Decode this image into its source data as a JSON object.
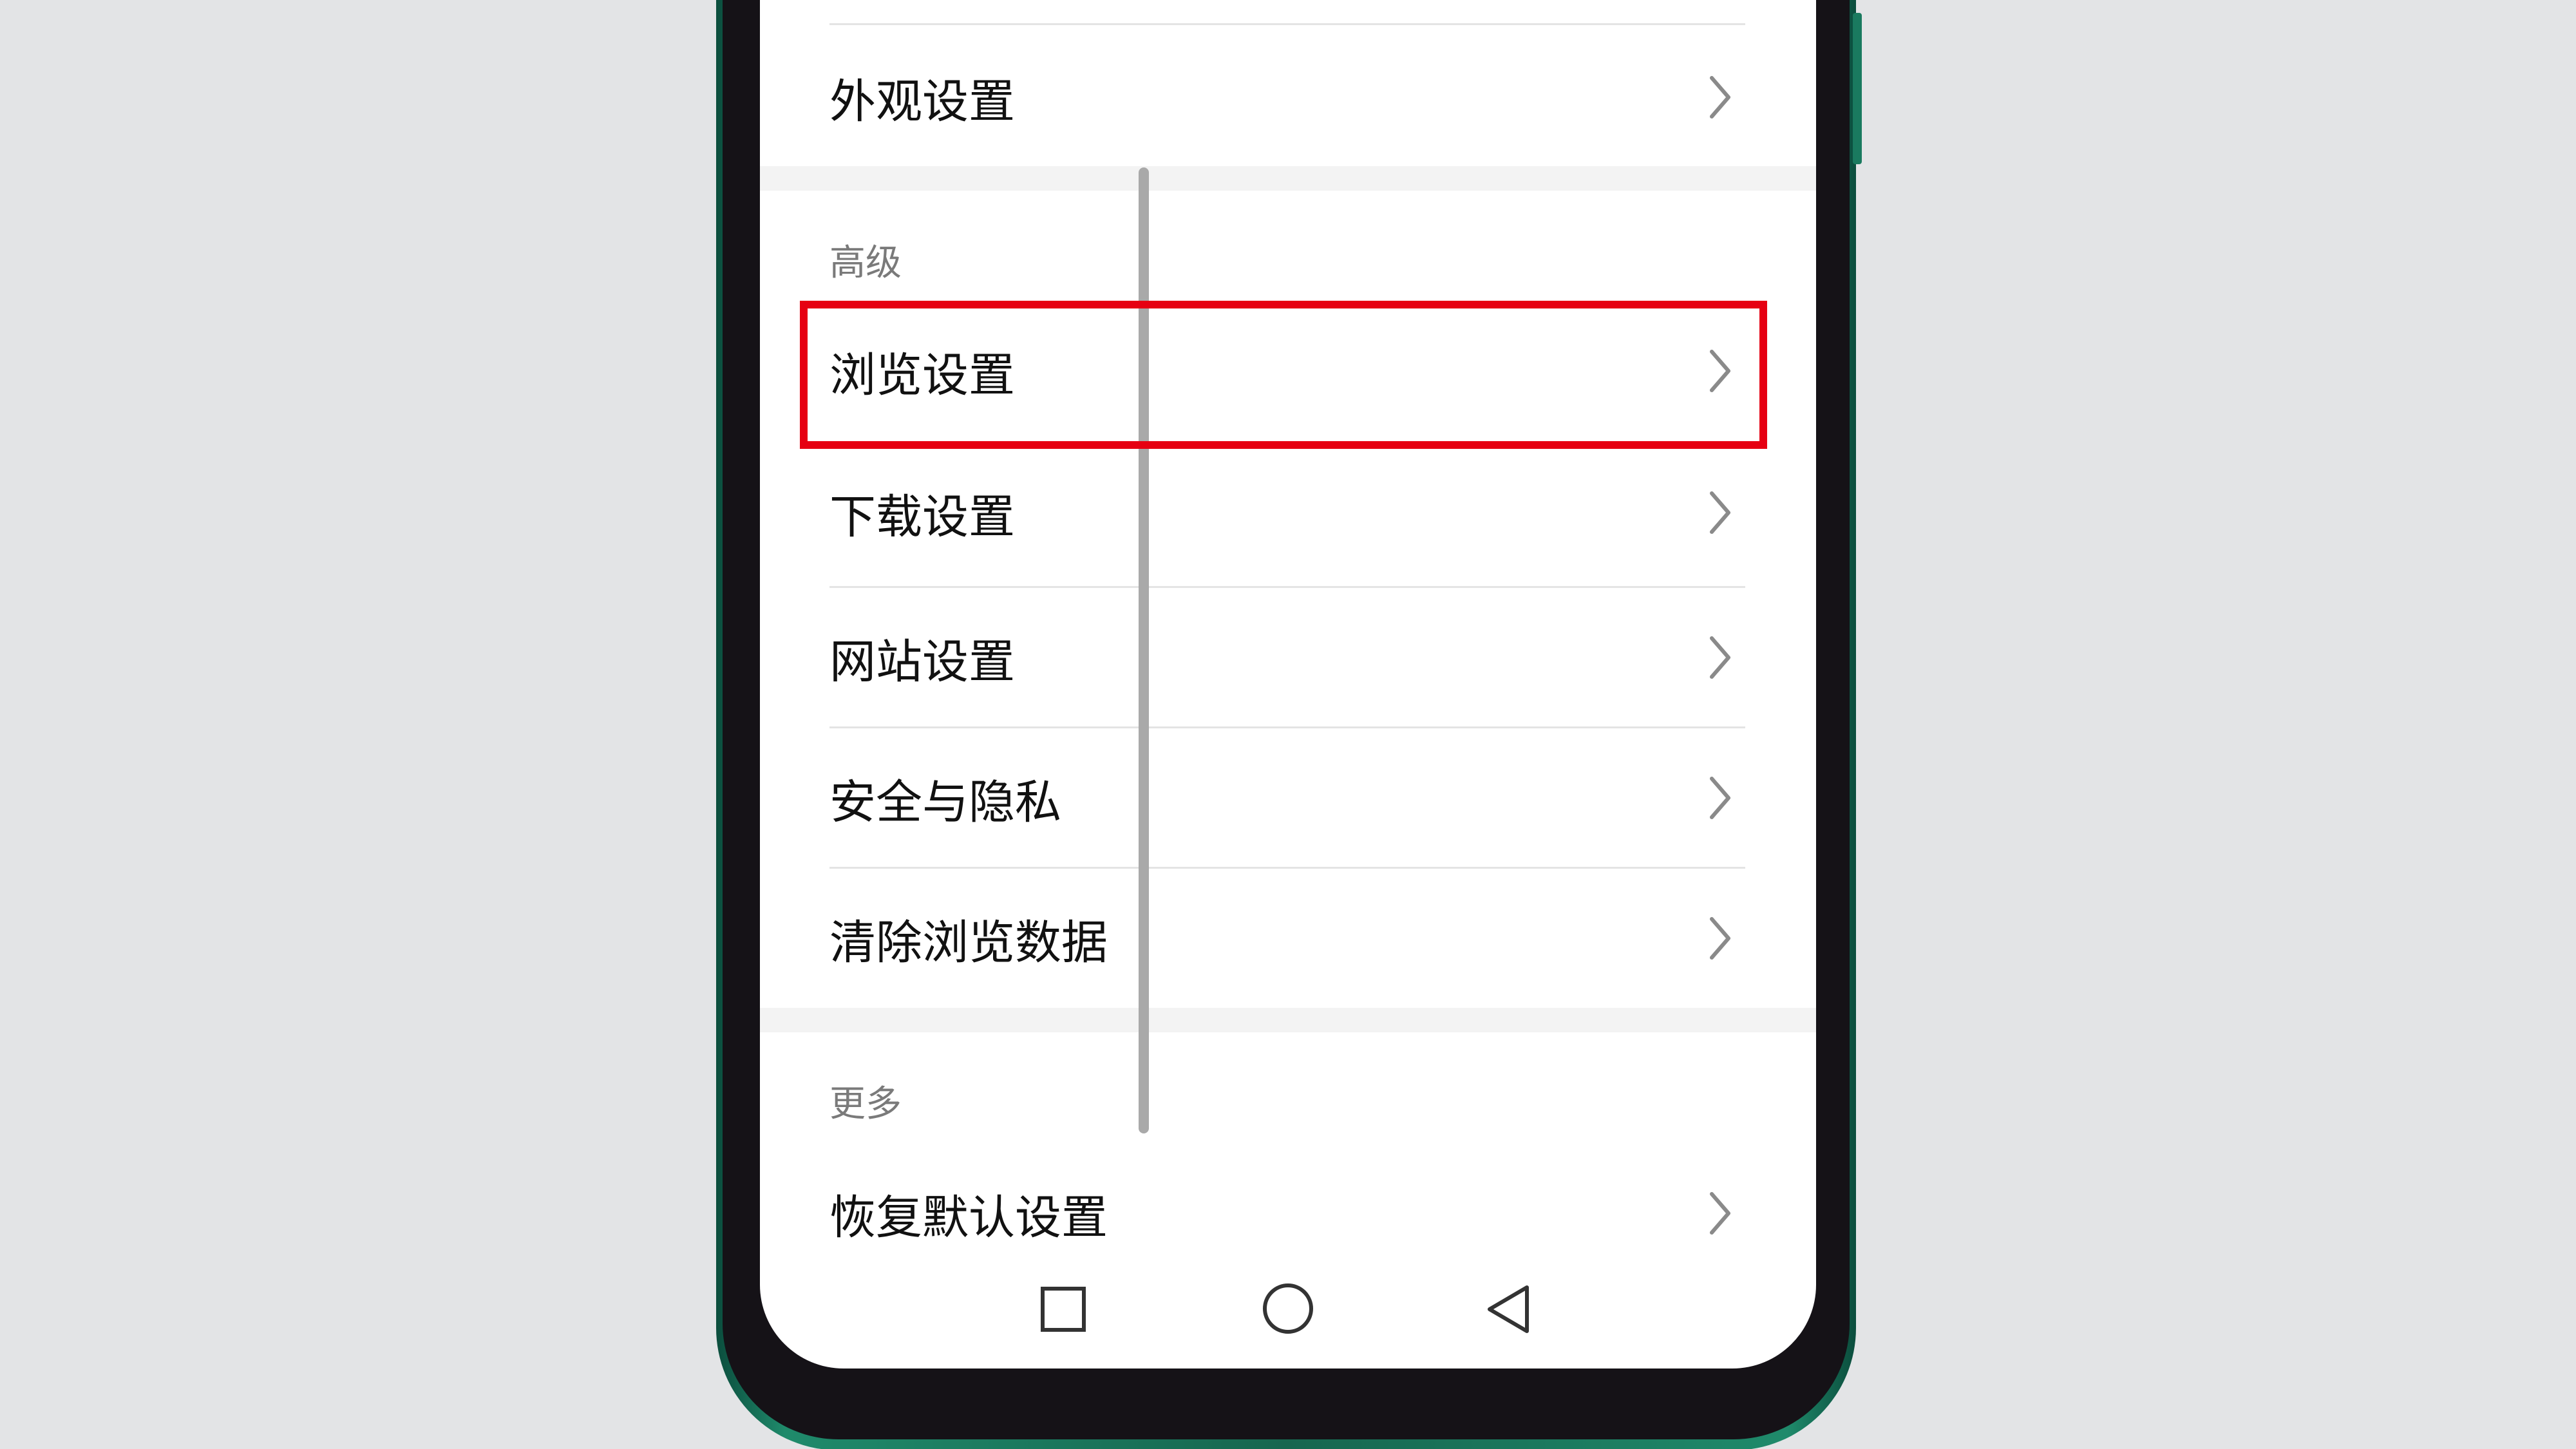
{
  "screen": {
    "background": "#ffffff",
    "highlight_color": "#e60012",
    "rows_top": [
      {
        "label": "外观设置",
        "icon": "chevron-right-icon"
      }
    ],
    "sections": [
      {
        "title": "高级",
        "items": [
          {
            "label": "浏览设置",
            "icon": "chevron-right-icon",
            "highlighted": true
          },
          {
            "label": "下载设置",
            "icon": "chevron-right-icon"
          },
          {
            "label": "网站设置",
            "icon": "chevron-right-icon"
          },
          {
            "label": "安全与隐私",
            "icon": "chevron-right-icon"
          },
          {
            "label": "清除浏览数据",
            "icon": "chevron-right-icon"
          }
        ]
      },
      {
        "title": "更多",
        "items": [
          {
            "label": "恢复默认设置",
            "icon": "chevron-right-icon"
          }
        ]
      }
    ]
  },
  "nav_bar": {
    "buttons": [
      {
        "name": "recent-apps",
        "icon": "square-icon"
      },
      {
        "name": "home",
        "icon": "circle-icon"
      },
      {
        "name": "back",
        "icon": "triangle-back-icon"
      }
    ]
  }
}
